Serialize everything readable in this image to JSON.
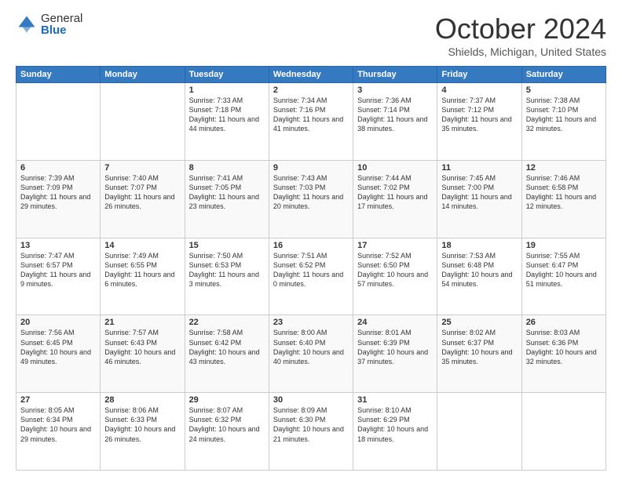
{
  "logo": {
    "general": "General",
    "blue": "Blue"
  },
  "header": {
    "month": "October 2024",
    "location": "Shields, Michigan, United States"
  },
  "days_of_week": [
    "Sunday",
    "Monday",
    "Tuesday",
    "Wednesday",
    "Thursday",
    "Friday",
    "Saturday"
  ],
  "weeks": [
    [
      {
        "day": "",
        "sunrise": "",
        "sunset": "",
        "daylight": ""
      },
      {
        "day": "",
        "sunrise": "",
        "sunset": "",
        "daylight": ""
      },
      {
        "day": "1",
        "sunrise": "Sunrise: 7:33 AM",
        "sunset": "Sunset: 7:18 PM",
        "daylight": "Daylight: 11 hours and 44 minutes."
      },
      {
        "day": "2",
        "sunrise": "Sunrise: 7:34 AM",
        "sunset": "Sunset: 7:16 PM",
        "daylight": "Daylight: 11 hours and 41 minutes."
      },
      {
        "day": "3",
        "sunrise": "Sunrise: 7:36 AM",
        "sunset": "Sunset: 7:14 PM",
        "daylight": "Daylight: 11 hours and 38 minutes."
      },
      {
        "day": "4",
        "sunrise": "Sunrise: 7:37 AM",
        "sunset": "Sunset: 7:12 PM",
        "daylight": "Daylight: 11 hours and 35 minutes."
      },
      {
        "day": "5",
        "sunrise": "Sunrise: 7:38 AM",
        "sunset": "Sunset: 7:10 PM",
        "daylight": "Daylight: 11 hours and 32 minutes."
      }
    ],
    [
      {
        "day": "6",
        "sunrise": "Sunrise: 7:39 AM",
        "sunset": "Sunset: 7:09 PM",
        "daylight": "Daylight: 11 hours and 29 minutes."
      },
      {
        "day": "7",
        "sunrise": "Sunrise: 7:40 AM",
        "sunset": "Sunset: 7:07 PM",
        "daylight": "Daylight: 11 hours and 26 minutes."
      },
      {
        "day": "8",
        "sunrise": "Sunrise: 7:41 AM",
        "sunset": "Sunset: 7:05 PM",
        "daylight": "Daylight: 11 hours and 23 minutes."
      },
      {
        "day": "9",
        "sunrise": "Sunrise: 7:43 AM",
        "sunset": "Sunset: 7:03 PM",
        "daylight": "Daylight: 11 hours and 20 minutes."
      },
      {
        "day": "10",
        "sunrise": "Sunrise: 7:44 AM",
        "sunset": "Sunset: 7:02 PM",
        "daylight": "Daylight: 11 hours and 17 minutes."
      },
      {
        "day": "11",
        "sunrise": "Sunrise: 7:45 AM",
        "sunset": "Sunset: 7:00 PM",
        "daylight": "Daylight: 11 hours and 14 minutes."
      },
      {
        "day": "12",
        "sunrise": "Sunrise: 7:46 AM",
        "sunset": "Sunset: 6:58 PM",
        "daylight": "Daylight: 11 hours and 12 minutes."
      }
    ],
    [
      {
        "day": "13",
        "sunrise": "Sunrise: 7:47 AM",
        "sunset": "Sunset: 6:57 PM",
        "daylight": "Daylight: 11 hours and 9 minutes."
      },
      {
        "day": "14",
        "sunrise": "Sunrise: 7:49 AM",
        "sunset": "Sunset: 6:55 PM",
        "daylight": "Daylight: 11 hours and 6 minutes."
      },
      {
        "day": "15",
        "sunrise": "Sunrise: 7:50 AM",
        "sunset": "Sunset: 6:53 PM",
        "daylight": "Daylight: 11 hours and 3 minutes."
      },
      {
        "day": "16",
        "sunrise": "Sunrise: 7:51 AM",
        "sunset": "Sunset: 6:52 PM",
        "daylight": "Daylight: 11 hours and 0 minutes."
      },
      {
        "day": "17",
        "sunrise": "Sunrise: 7:52 AM",
        "sunset": "Sunset: 6:50 PM",
        "daylight": "Daylight: 10 hours and 57 minutes."
      },
      {
        "day": "18",
        "sunrise": "Sunrise: 7:53 AM",
        "sunset": "Sunset: 6:48 PM",
        "daylight": "Daylight: 10 hours and 54 minutes."
      },
      {
        "day": "19",
        "sunrise": "Sunrise: 7:55 AM",
        "sunset": "Sunset: 6:47 PM",
        "daylight": "Daylight: 10 hours and 51 minutes."
      }
    ],
    [
      {
        "day": "20",
        "sunrise": "Sunrise: 7:56 AM",
        "sunset": "Sunset: 6:45 PM",
        "daylight": "Daylight: 10 hours and 49 minutes."
      },
      {
        "day": "21",
        "sunrise": "Sunrise: 7:57 AM",
        "sunset": "Sunset: 6:43 PM",
        "daylight": "Daylight: 10 hours and 46 minutes."
      },
      {
        "day": "22",
        "sunrise": "Sunrise: 7:58 AM",
        "sunset": "Sunset: 6:42 PM",
        "daylight": "Daylight: 10 hours and 43 minutes."
      },
      {
        "day": "23",
        "sunrise": "Sunrise: 8:00 AM",
        "sunset": "Sunset: 6:40 PM",
        "daylight": "Daylight: 10 hours and 40 minutes."
      },
      {
        "day": "24",
        "sunrise": "Sunrise: 8:01 AM",
        "sunset": "Sunset: 6:39 PM",
        "daylight": "Daylight: 10 hours and 37 minutes."
      },
      {
        "day": "25",
        "sunrise": "Sunrise: 8:02 AM",
        "sunset": "Sunset: 6:37 PM",
        "daylight": "Daylight: 10 hours and 35 minutes."
      },
      {
        "day": "26",
        "sunrise": "Sunrise: 8:03 AM",
        "sunset": "Sunset: 6:36 PM",
        "daylight": "Daylight: 10 hours and 32 minutes."
      }
    ],
    [
      {
        "day": "27",
        "sunrise": "Sunrise: 8:05 AM",
        "sunset": "Sunset: 6:34 PM",
        "daylight": "Daylight: 10 hours and 29 minutes."
      },
      {
        "day": "28",
        "sunrise": "Sunrise: 8:06 AM",
        "sunset": "Sunset: 6:33 PM",
        "daylight": "Daylight: 10 hours and 26 minutes."
      },
      {
        "day": "29",
        "sunrise": "Sunrise: 8:07 AM",
        "sunset": "Sunset: 6:32 PM",
        "daylight": "Daylight: 10 hours and 24 minutes."
      },
      {
        "day": "30",
        "sunrise": "Sunrise: 8:09 AM",
        "sunset": "Sunset: 6:30 PM",
        "daylight": "Daylight: 10 hours and 21 minutes."
      },
      {
        "day": "31",
        "sunrise": "Sunrise: 8:10 AM",
        "sunset": "Sunset: 6:29 PM",
        "daylight": "Daylight: 10 hours and 18 minutes."
      },
      {
        "day": "",
        "sunrise": "",
        "sunset": "",
        "daylight": ""
      },
      {
        "day": "",
        "sunrise": "",
        "sunset": "",
        "daylight": ""
      }
    ]
  ]
}
